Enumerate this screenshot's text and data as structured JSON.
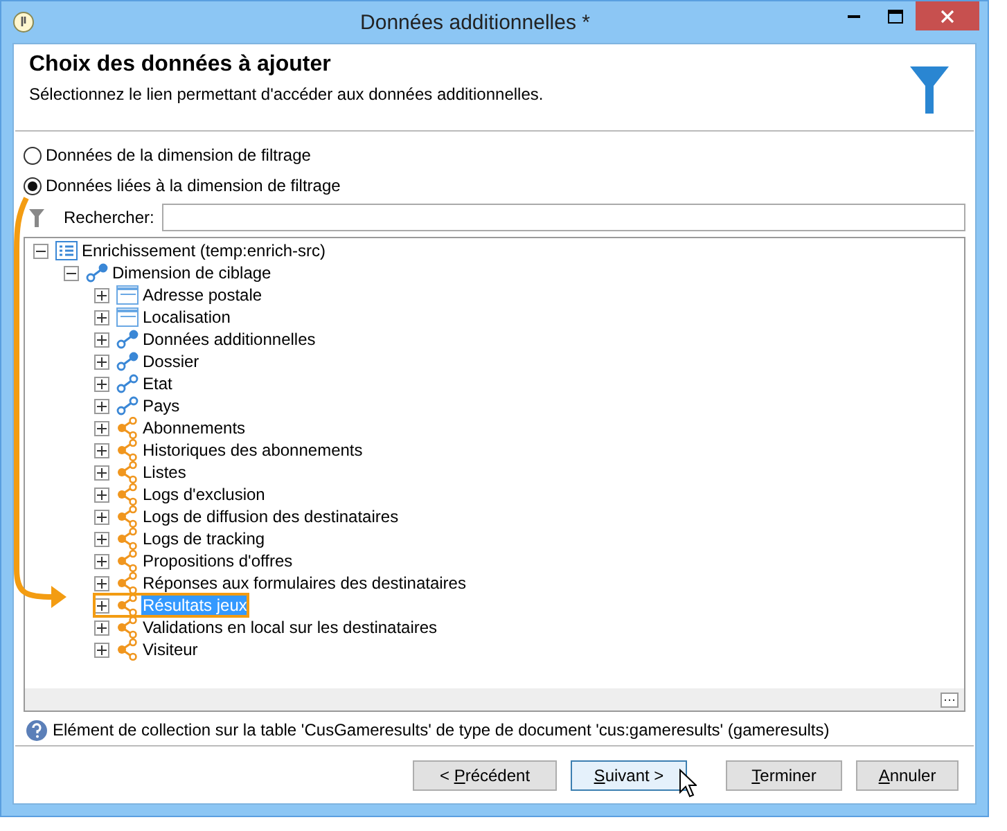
{
  "window": {
    "title": "Données additionnelles *"
  },
  "header": {
    "title": "Choix des données à ajouter",
    "subtitle": "Sélectionnez le lien permettant d'accéder aux données additionnelles."
  },
  "options": [
    {
      "label": "Données de la dimension de filtrage",
      "selected": false
    },
    {
      "label": "Données liées à la dimension de filtrage",
      "selected": true
    }
  ],
  "search": {
    "label": "Rechercher:"
  },
  "tree": [
    {
      "label": "Enrichissement (temp:enrich-src)",
      "kind": "list-root",
      "expanded": true,
      "selected": false,
      "children": [
        {
          "label": "Dimension de ciblage",
          "kind": "link-filled",
          "expanded": true,
          "selected": false,
          "children": [
            {
              "label": "Adresse postale",
              "kind": "table",
              "expanded": false,
              "selected": false
            },
            {
              "label": "Localisation",
              "kind": "table",
              "expanded": false,
              "selected": false
            },
            {
              "label": "Données additionnelles",
              "kind": "link-filled",
              "expanded": false,
              "selected": false
            },
            {
              "label": "Dossier",
              "kind": "link-filled",
              "expanded": false,
              "selected": false
            },
            {
              "label": "Etat",
              "kind": "link",
              "expanded": false,
              "selected": false
            },
            {
              "label": "Pays",
              "kind": "link",
              "expanded": false,
              "selected": false
            },
            {
              "label": "Abonnements",
              "kind": "collection",
              "expanded": false,
              "selected": false
            },
            {
              "label": "Historiques des abonnements",
              "kind": "collection",
              "expanded": false,
              "selected": false
            },
            {
              "label": "Listes",
              "kind": "collection",
              "expanded": false,
              "selected": false
            },
            {
              "label": "Logs d'exclusion",
              "kind": "collection",
              "expanded": false,
              "selected": false
            },
            {
              "label": "Logs de diffusion des destinataires",
              "kind": "collection",
              "expanded": false,
              "selected": false
            },
            {
              "label": "Logs de tracking",
              "kind": "collection",
              "expanded": false,
              "selected": false
            },
            {
              "label": "Propositions d'offres",
              "kind": "collection",
              "expanded": false,
              "selected": false
            },
            {
              "label": "Réponses aux formulaires des destinataires",
              "kind": "collection",
              "expanded": false,
              "selected": false
            },
            {
              "label": "Résultats jeux",
              "kind": "collection",
              "expanded": false,
              "selected": true
            },
            {
              "label": "Validations en local sur les destinataires",
              "kind": "collection",
              "expanded": false,
              "selected": false
            },
            {
              "label": "Visiteur",
              "kind": "collection",
              "expanded": false,
              "selected": false
            }
          ]
        }
      ]
    }
  ],
  "status": "Elément de collection sur la table 'CusGameresults' de type de document 'cus:gameresults' (gameresults)",
  "buttons": [
    {
      "label": "< Précédent",
      "focused": false
    },
    {
      "label": "Suivant >",
      "focused": true
    },
    {
      "label": "Terminer",
      "focused": false
    },
    {
      "label": "Annuler",
      "focused": false
    }
  ]
}
